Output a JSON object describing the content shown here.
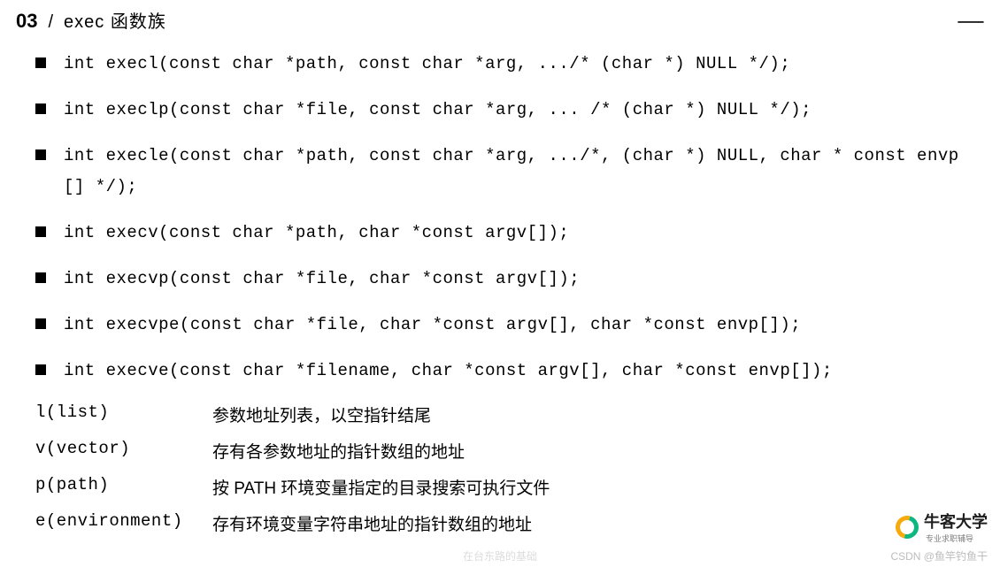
{
  "header": {
    "slide_number": "03",
    "slash": "/",
    "title": "exec 函数族",
    "menu_glyph": "⸺"
  },
  "functions": [
    "int execl(const char *path, const char *arg, .../* (char  *) NULL */);",
    "int execlp(const char *file, const char *arg, ... /* (char  *) NULL */);",
    "int execle(const char *path, const char *arg, .../*, (char *) NULL, char * const envp[] */);",
    "int execv(const char *path, char *const argv[]);",
    "int execvp(const char *file, char *const argv[]);",
    "int execvpe(const char *file, char *const argv[], char *const envp[]);",
    "int execve(const char *filename, char *const argv[], char *const envp[]);"
  ],
  "suffixes": [
    {
      "key": "l(list)",
      "desc": "参数地址列表，以空指针结尾"
    },
    {
      "key": "v(vector)",
      "desc": "存有各参数地址的指针数组的地址"
    },
    {
      "key": "p(path)",
      "desc": "按 PATH 环境变量指定的目录搜索可执行文件"
    },
    {
      "key": "e(environment)",
      "desc": "存有环境变量字符串地址的指针数组的地址"
    }
  ],
  "brand": {
    "name": "牛客大学",
    "sub": "专业求职辅导"
  },
  "footer": {
    "csdn": "CSDN @鱼竿钓鱼干",
    "shadow": "在台东路的基础"
  }
}
